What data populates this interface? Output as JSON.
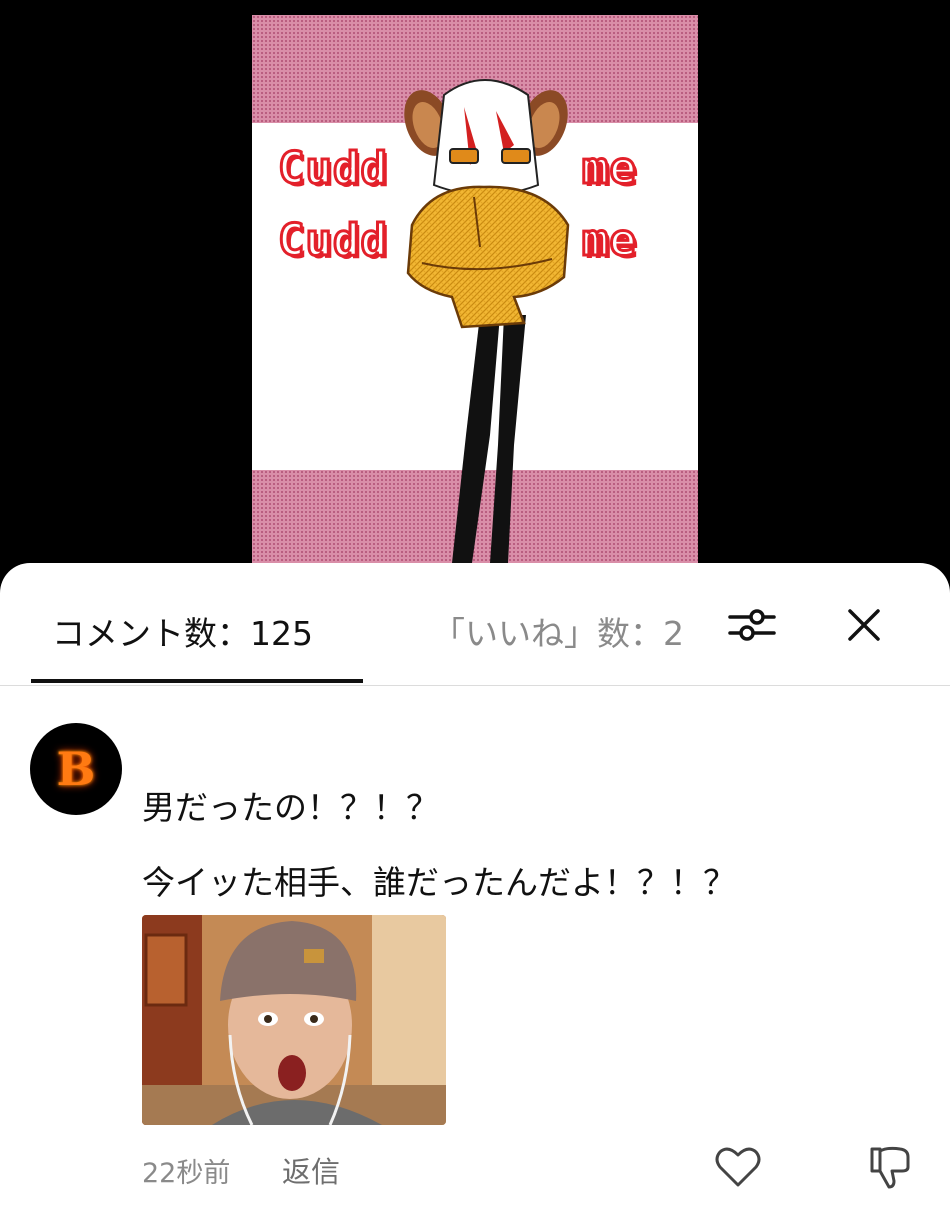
{
  "video": {
    "text_left_1": "Cudd",
    "text_left_2": "Cudd",
    "text_right_1": "me",
    "text_right_2": "me"
  },
  "tabs": {
    "comments_label": "コメント数：125",
    "likes_label": "「いいね」数：2"
  },
  "icons": {
    "filter": "filter-sliders-icon",
    "close": "close-icon",
    "like": "heart-icon",
    "dislike": "thumbs-down-icon"
  },
  "comment": {
    "avatar_letter": "B",
    "line1": "男だったの！？！？",
    "line2": "今イッた相手、誰だったんだよ！？！？",
    "time": "22秒前",
    "reply_label": "返信"
  },
  "colors": {
    "accent_red": "#e3202a",
    "band_pink": "#d98ea8",
    "muted_text": "#8a8a8a"
  }
}
